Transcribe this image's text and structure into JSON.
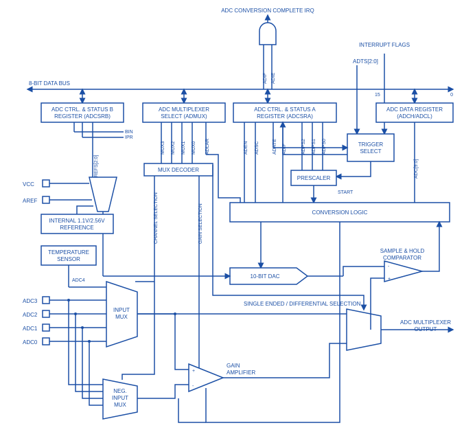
{
  "top": {
    "irq": "ADC CONVERSION\nCOMPLETE IRQ",
    "int_flags": "INTERRUPT\nFLAGS",
    "adts": "ADTS[2:0]",
    "bus": "8-BIT DATA BUS",
    "bus_15": "15",
    "bus_0": "0"
  },
  "regs": {
    "adcsrb_t": "ADC CTRL. & STATUS B",
    "adcsrb_b": "REGISTER (ADCSRB)",
    "admux_t": "ADC MULTIPLEXER",
    "admux_b": "SELECT (ADMUX)",
    "adcsra_t": "ADC CTRL. & STATUS A",
    "adcsra_b": "REGISTER (ADCSRA)",
    "datareg_t": "ADC DATA REGISTER",
    "datareg_b": "(ADCH/ADCL)"
  },
  "sigs": {
    "bin": "BIN",
    "ipr": "IPR",
    "refs": "REFS[2:0]",
    "mux3": "MUX3",
    "mux2": "MUX2",
    "mux1": "MUX1",
    "mux0": "MUX0",
    "adlar": "ADLAR",
    "aden": "ADEN",
    "adsc": "ADSC",
    "adate": "ADATE",
    "adif": "ADIF",
    "adie": "ADIE",
    "adps2": "ADPS2",
    "adps1": "ADPS1",
    "adps0": "ADPS0",
    "adc90": "ADC[9:0]",
    "start": "START"
  },
  "blocks": {
    "muxdec": "MUX DECODER",
    "chan_sel": "CHANNEL SELECTION",
    "gain_sel": "GAIN SELECTION",
    "trigger": "TRIGGER\nSELECT",
    "prescaler": "PRESCALER",
    "convlogic": "CONVERSION LOGIC",
    "dac": "10-BIT DAC",
    "comp": "SAMPLE & HOLD\nCOMPARATOR",
    "tempsens": "TEMPERATURE\nSENSOR",
    "inputmux": "INPUT\nMUX",
    "negmux": "NEG.\nINPUT\nMUX",
    "gainamp": "GAIN\nAMPLIFIER",
    "intref": "INTERNAL 1.1V/2.56V\nREFERENCE",
    "sediff": "SINGLE ENDED / DIFFERENTIAL SELECTION",
    "muxout": "ADC MULTIPLEXER\nOUTPUT"
  },
  "pins": {
    "vcc": "VCC",
    "aref": "AREF",
    "adc4": "ADC4",
    "adc3": "ADC3",
    "adc2": "ADC2",
    "adc1": "ADC1",
    "adc0": "ADC0"
  }
}
